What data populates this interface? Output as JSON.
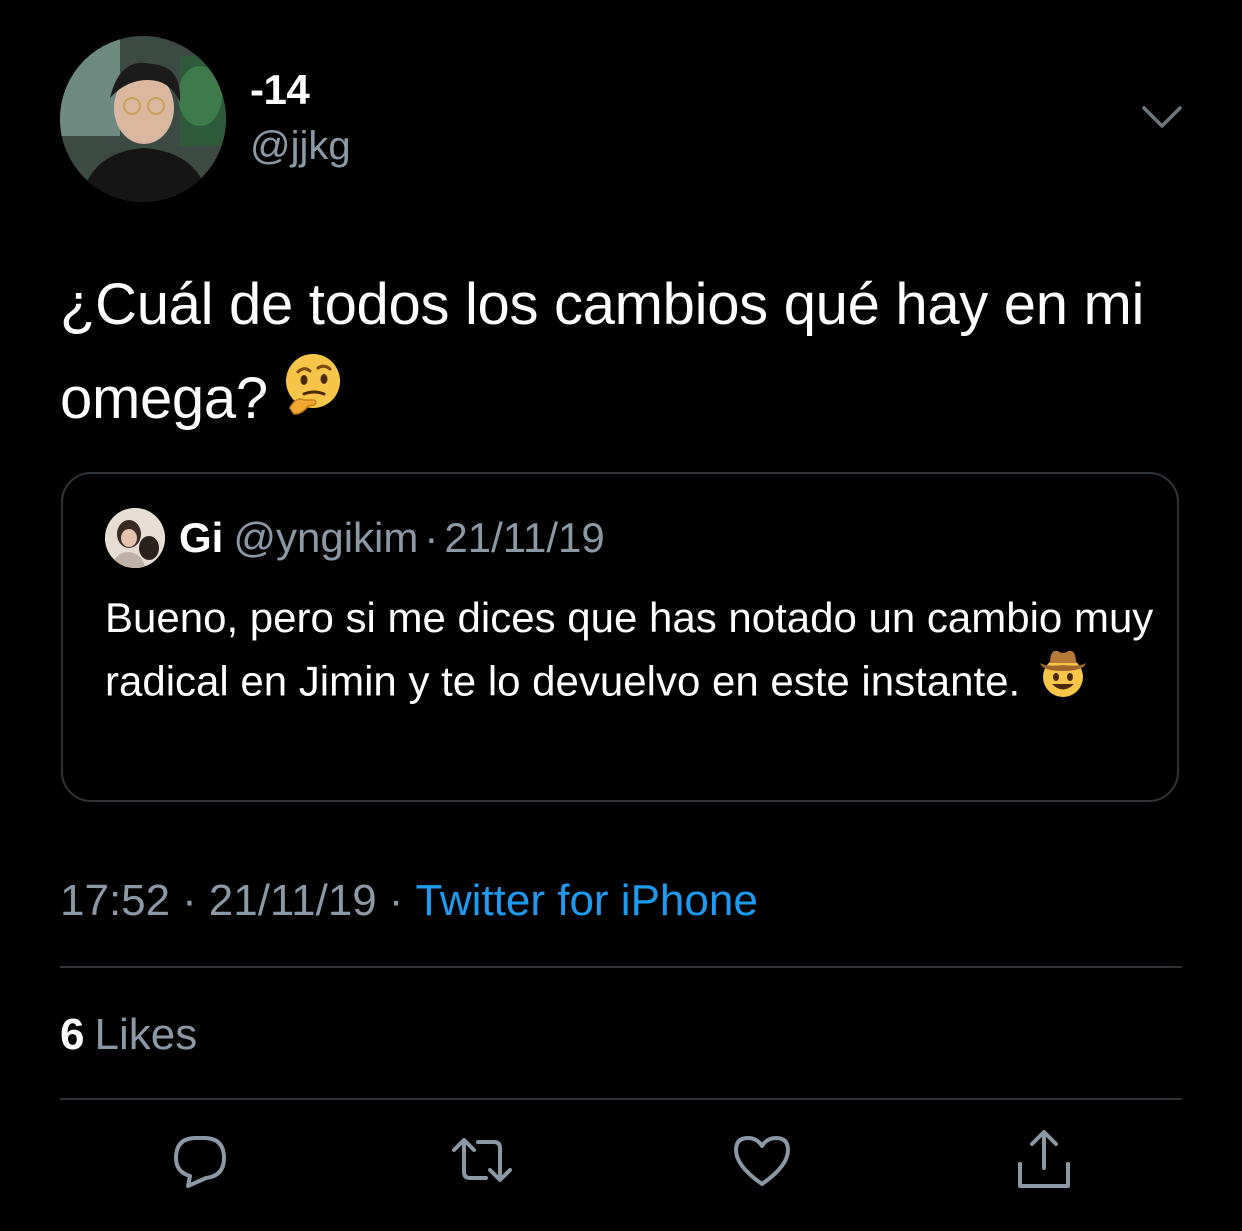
{
  "author": {
    "display_name": "-14",
    "handle": "@jjkg"
  },
  "tweet": {
    "text": "¿Cuál de todos los cambios qué hay en mi omega?",
    "emoji": "thinking-face"
  },
  "quoted_tweet": {
    "name": "Gi",
    "handle": "@yngikim",
    "separator": "·",
    "date": "21/11/19",
    "text": "Bueno, pero si me dices que has notado un cambio muy radical en Jimin y te lo devuelvo en este instante.",
    "emoji": "cowboy-hat-face"
  },
  "meta": {
    "time": "17:52",
    "separator": "·",
    "date": "21/11/19",
    "source": "Twitter for iPhone"
  },
  "stats": {
    "likes_count": "6",
    "likes_label": "Likes"
  },
  "actions": {
    "reply": "reply-icon",
    "retweet": "retweet-icon",
    "like": "heart-icon",
    "share": "share-icon"
  },
  "colors": {
    "background": "#000000",
    "text": "#ffffff",
    "secondary": "#8b98a5",
    "accent": "#1d9bf0",
    "border": "#2f3336"
  }
}
